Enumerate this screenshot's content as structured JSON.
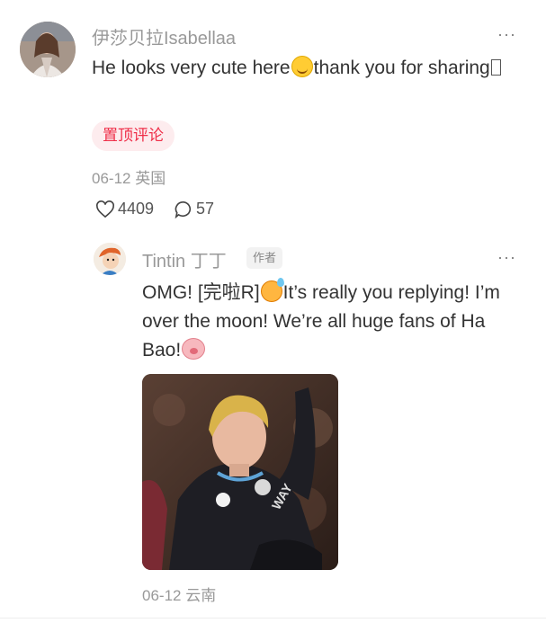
{
  "comment": {
    "username": "伊莎贝拉Isabellaa",
    "text_part1": "He looks very cute here",
    "text_part2": "thank you for sharing",
    "pinned_label": "置顶评论",
    "date_location": "06-12 英国",
    "likes": "4409",
    "replies": "57",
    "more_label": "···"
  },
  "reply": {
    "username": "Tintin 丁丁",
    "author_tag": "作者",
    "text_part1": "OMG! [完啦R]",
    "text_part2": "It’s really you replying! I’m over the moon! We’re all huge fans of Ha Bao!",
    "date_location": "06-12 云南",
    "more_label": "···",
    "photo_kit_text": "WAY"
  },
  "colors": {
    "accent_red": "#ef2e48",
    "muted": "#999999",
    "text": "#333333"
  }
}
